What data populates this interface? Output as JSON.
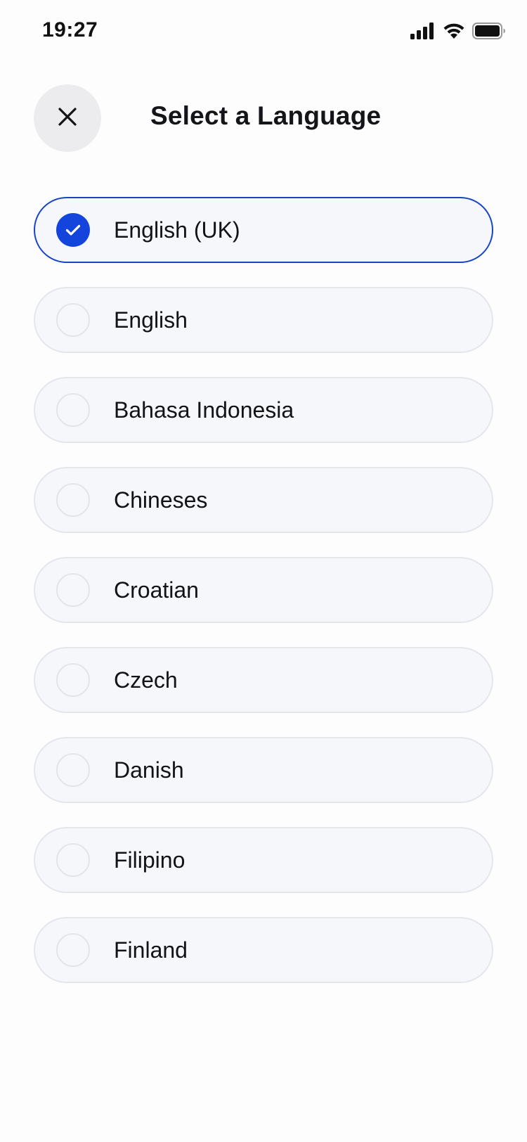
{
  "status_bar": {
    "time": "19:27",
    "icons": [
      "cellular-signal-icon",
      "wifi-icon",
      "battery-icon"
    ]
  },
  "header": {
    "close_icon": "close-icon",
    "title": "Select a Language"
  },
  "languages": [
    {
      "label": "English (UK)",
      "selected": true
    },
    {
      "label": "English",
      "selected": false
    },
    {
      "label": "Bahasa Indonesia",
      "selected": false
    },
    {
      "label": "Chineses",
      "selected": false
    },
    {
      "label": "Croatian",
      "selected": false
    },
    {
      "label": "Czech",
      "selected": false
    },
    {
      "label": "Danish",
      "selected": false
    },
    {
      "label": "Filipino",
      "selected": false
    },
    {
      "label": "Finland",
      "selected": false
    }
  ],
  "colors": {
    "accent": "#1345dd",
    "selected_border": "#1745c4",
    "item_background": "#f5f7fb",
    "item_border": "#e4e6ec",
    "close_button_bg": "#ececee"
  }
}
